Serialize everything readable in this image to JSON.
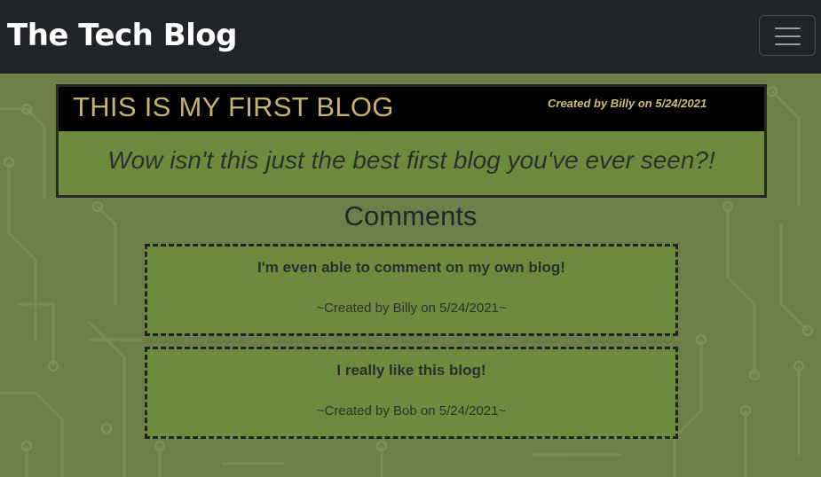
{
  "navbar": {
    "brand": "The Tech Blog",
    "toggle_icon": "hamburger-menu-icon"
  },
  "post": {
    "title": "THIS IS MY FIRST BLOG",
    "meta": "Created by Billy on 5/24/2021",
    "content": "Wow isn't this just the best first blog you've ever seen?!"
  },
  "comments": {
    "heading": "Comments",
    "items": [
      {
        "text": "I'm even able to comment on my own blog!",
        "meta": "~Created by Billy on 5/24/2021~"
      },
      {
        "text": "I really like this blog!",
        "meta": "~Created by Bob on 5/24/2021~"
      }
    ]
  },
  "colors": {
    "navbar": "#212529",
    "background": "#6e8049",
    "card": "#6e8b3d",
    "title_gold": "#c6b36f"
  }
}
